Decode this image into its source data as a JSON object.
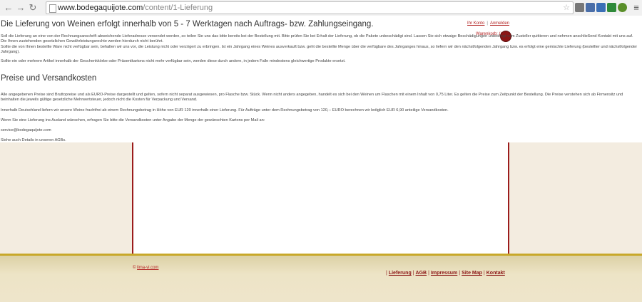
{
  "browser": {
    "url_host": "www.bodegaquijote.com",
    "url_path": "/content/1-Lieferung",
    "back_icon": "arrow-left",
    "forward_icon": "arrow-right",
    "reload_icon": "reload"
  },
  "header": {
    "account_link": "Ihr Konto",
    "login_link": "Anmelden",
    "cart_label": "Warenkorb: (Leer)"
  },
  "page": {
    "headline": "Die Lieferung von Weinen erfolgt innerhalb von 5 - 7 Werktagen nach Auftrags- bzw. Zahlungseingang.",
    "p1": "Soll die Lieferung an eine von der Rechnungsanschrift abweichende Lieferadresse versendet werden, so teilen Sie uns das bitte bereits bei der Bestellung mit. Bitte prüfen Sie bei Erhalt der Lieferung, ob die Pakete unbeschädigt sind. Lassen Sie sich etwaige Beschädigungen unbedingt vom Zusteller quittieren und nehmen anschließend Kontakt mit uns auf. Die Ihnen zustehenden gesetzlichen Gewährleistungsrechte werden hierdurch nicht berührt.",
    "p2": "Sollte die von Ihnen bestellte Ware nicht verfügbar sein, behalten wir uns vor, die Leistung nicht oder verzögert zu erbringen. Ist ein Jahrgang eines Weines ausverkauft bzw. geht die bestellte Menge über die verfügbare des Jahrganges hinaus, so liefern wir den nächstfolgenden Jahrgang bzw. es erfolgt eine gemischte Lieferung (bestellter und nächstfolgender Jahrgang).",
    "p3": "Sollte ein oder mehrere Artikel innerhalb der Geschenkkörbe oder Präsentkartons nicht mehr verfügbar sein, werden diese durch andere, in jedem Falle mindestens gleichwertige Produkte ersetzt.",
    "section_title": "Preise und Versandkosten",
    "p4": "Alle angegebenen Preise sind Bruttopreise und als EURO-Preise dargestellt und gelten, sofern nicht separat ausgewiesen, pro Flasche bzw. Stück. Wenn nicht anders angegeben, handelt es sich bei den Weinen um Flaschen mit einem Inhalt von 0,75 Liter. Es gelten die Preise zum Zeitpunkt der Bestellung. Die Preise verstehen sich ab Firmensitz und beinhalten die jeweils gültige gesetzliche Mehrwertsteuer, jedoch nicht die Kosten für Verpackung und Versand.",
    "p5": "Innerhalb Deutschland liefern wir unsere Weine frachtfrei ab einem Rechnungsbetrag in Höhe von EUR 120 innerhalb einer Lieferung. Für Aufträge unter dem Rechnungsbetrag von 120,-- EURO berechnen wir lediglich EUR 6,90 anteilige Versandkosten.",
    "p6": "Wenn Sie eine Lieferung ins Ausland wünschen, erfragen Sie bitte die Versandkosten unter Angabe der Menge der gewünschten Kartons per Mail an:",
    "p7": "service@bodegaquijote.com",
    "p8": "Siehe auch Details in unseren AGBs."
  },
  "footer": {
    "copyright_symbol": "©",
    "copyright_link": "lima-vi.com",
    "links": [
      "Lieferung",
      "AGB",
      "Impressum",
      "Site Map",
      "Kontakt"
    ]
  },
  "colors": {
    "accent": "#9b1b1b",
    "side_panel": "#f3ece0",
    "footer_gold": "#c8a82a"
  }
}
